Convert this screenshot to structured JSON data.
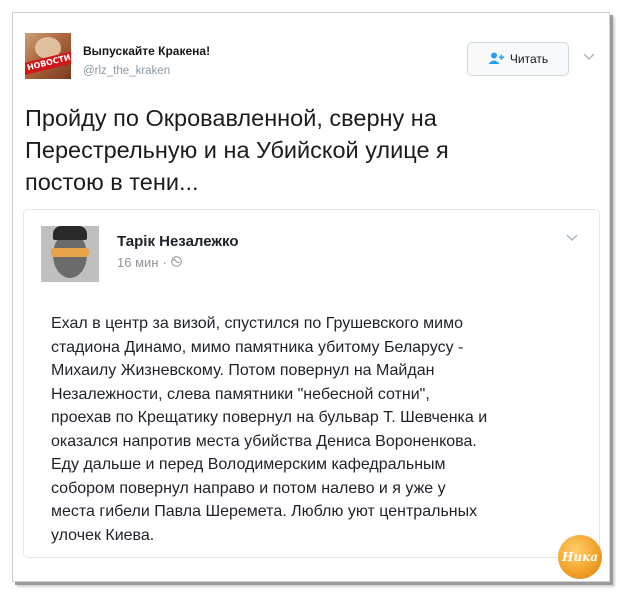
{
  "tweet": {
    "author_name": "Выпускайте Кракена!",
    "handle": "@rlz_the_kraken",
    "follow_label": "Читать",
    "avatar_banner": "НОВОСТИ",
    "text_lines": [
      "Пройду по Окровавленной, сверну на",
      "Перестрельную и на Убийской улице я",
      "постою в тени..."
    ]
  },
  "quoted_post": {
    "author_name": "Тарік Незалежко",
    "time": "16 мин",
    "text_lines": [
      "Ехал в центр за визой, спустился по Грушевского мимо",
      "стадиона Динамо, мимо памятника убитому  Беларусу -",
      "Михаилу Жизневскому. Потом повернул на Майдан",
      "Незалежности, слева памятники \"небесной сотни\",",
      "проехав по Крещатику повернул на бульвар Т. Шевченка и",
      "оказался напротив  места убийства Дениса Вороненкова.",
      "Еду дальше и перед Володимерским кафедральным",
      "собором повернул направо и потом налево и я уже у",
      "места гибели Павла Шеремета. Люблю уют центральных",
      "улочек Киева."
    ]
  },
  "watermark": "Ника",
  "icons": {
    "follow": "add-user-icon",
    "menu": "chevron-down-icon",
    "audience": "globe-icon"
  },
  "colors": {
    "twitter_blue": "#1da1f2",
    "muted": "#8899a6"
  }
}
